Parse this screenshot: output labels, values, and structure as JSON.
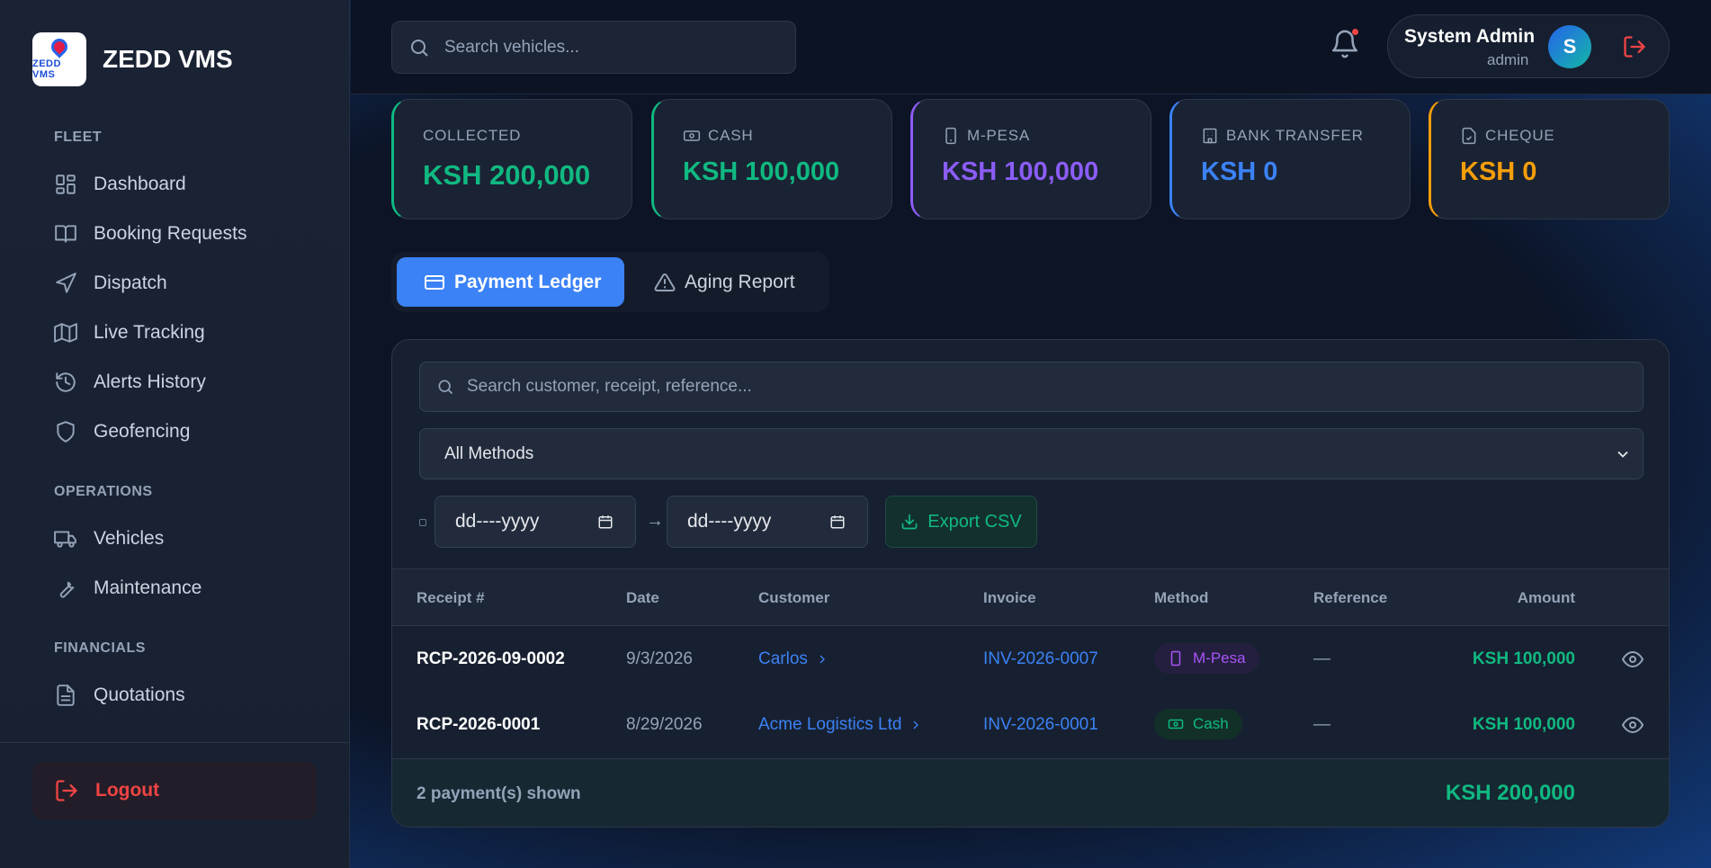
{
  "brand": {
    "name": "ZEDD VMS",
    "logo_text": "ZEDD VMS"
  },
  "sidebar": {
    "sections": [
      {
        "label": "FLEET"
      },
      {
        "label": "OPERATIONS"
      },
      {
        "label": "FINANCIALS"
      }
    ],
    "items": [
      {
        "label": "Dashboard",
        "icon": "dashboard-icon"
      },
      {
        "label": "Booking Requests",
        "icon": "book-icon"
      },
      {
        "label": "Dispatch",
        "icon": "navigation-icon"
      },
      {
        "label": "Live Tracking",
        "icon": "map-icon"
      },
      {
        "label": "Alerts History",
        "icon": "history-icon"
      },
      {
        "label": "Geofencing",
        "icon": "shield-icon"
      },
      {
        "label": "Vehicles",
        "icon": "truck-icon"
      },
      {
        "label": "Maintenance",
        "icon": "wrench-icon"
      },
      {
        "label": "Quotations",
        "icon": "document-icon"
      }
    ],
    "logout_label": "Logout"
  },
  "topbar": {
    "search_placeholder": "Search vehicles...",
    "user_name": "System Admin",
    "user_role": "admin",
    "avatar_initial": "S"
  },
  "stats": [
    {
      "label": "COLLECTED",
      "value": "KSH 200,000",
      "color": "#10b981",
      "border": "#10b981",
      "icon": ""
    },
    {
      "label": "CASH",
      "value": "KSH 100,000",
      "color": "#10b981",
      "border": "#10b981",
      "icon": "cash-icon"
    },
    {
      "label": "M-PESA",
      "value": "KSH 100,000",
      "color": "#8b5cf6",
      "border": "#8b5cf6",
      "icon": "phone-icon"
    },
    {
      "label": "BANK TRANSFER",
      "value": "KSH 0",
      "color": "#3b82f6",
      "border": "#3b82f6",
      "icon": "bank-icon"
    },
    {
      "label": "CHEQUE",
      "value": "KSH 0",
      "color": "#f59e0b",
      "border": "#f59e0b",
      "icon": "cheque-icon"
    }
  ],
  "tabs": [
    {
      "label": "Payment Ledger",
      "active": true
    },
    {
      "label": "Aging Report",
      "active": false
    }
  ],
  "filters": {
    "search_placeholder": "Search customer, receipt, reference...",
    "method_selected": "All Methods",
    "date_from": "dd----yyyy",
    "date_to": "dd----yyyy",
    "date_arrow": "→",
    "export_label": "Export CSV"
  },
  "table": {
    "columns": [
      "Receipt #",
      "Date",
      "Customer",
      "Invoice",
      "Method",
      "Reference",
      "Amount"
    ],
    "rows": [
      {
        "receipt": "RCP-2026-09-0002",
        "date": "9/3/2026",
        "customer": "Carlos",
        "invoice": "INV-2026-0007",
        "method": "M-Pesa",
        "reference": "—",
        "amount": "KSH 100,000"
      },
      {
        "receipt": "RCP-2026-0001",
        "date": "8/29/2026",
        "customer": "Acme Logistics Ltd",
        "invoice": "INV-2026-0001",
        "method": "Cash",
        "reference": "—",
        "amount": "KSH 100,000"
      }
    ],
    "footer_count": "2 payment(s) shown",
    "footer_total": "KSH 200,000"
  }
}
